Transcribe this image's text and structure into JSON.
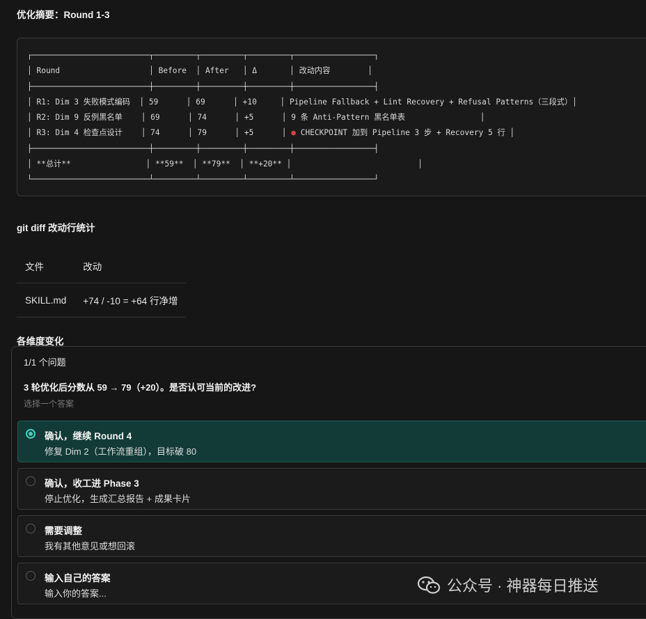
{
  "summary": {
    "title": "优化摘要：Round 1-3",
    "table_ascii": "┌─────────────────────────┬─────────┬─────────┬─────────┬─────────────────┐\n│ Round                   │ Before  │ After   │ Δ       │ 改动内容        │\n├─────────────────────────┼─────────┼─────────┼─────────┼─────────────────┤\n│ R1: Dim 3 失败模式编码  │ 59      │ 69      │ +10     │ Pipeline Fallback + Lint Recovery + Refusal Patterns（三段式）│\n│ R2: Dim 9 反例黑名单    │ 69      │ 74      │ +5      │ 9 条 Anti-Pattern 黑名单表                │\n│ R3: Dim 4 检查点设计    │ 74      │ 79      │ +5      │ ● CHECKPOINT 加到 Pipeline 3 步 + Recovery 5 行 │\n├─────────────────────────┼─────────┼─────────┼─────────┼─────────────────┤\n│ **总计**                │ **59**  │ **79**  │ **+20** │                           │\n└─────────────────────────┴─────────┴─────────┴─────────┴─────────────────┘"
  },
  "diff": {
    "title": "git diff 改动行统计",
    "headers": [
      "文件",
      "改动"
    ],
    "rows": [
      [
        "SKILL.md",
        "+74 / -10 = +64 行净增"
      ]
    ]
  },
  "dimensions": {
    "title": "各维度变化"
  },
  "question": {
    "count": "1/1 个问题",
    "text": "3 轮优化后分数从 59 → 79（+20）。是否认可当前的改进?",
    "hint": "选择一个答案",
    "options": [
      {
        "title": "确认，继续 Round 4",
        "desc": "修复 Dim 2（工作流重组），目标破 80",
        "selected": true
      },
      {
        "title": "确认，收工进 Phase 3",
        "desc": "停止优化，生成汇总报告 + 成果卡片",
        "selected": false
      },
      {
        "title": "需要调整",
        "desc": "我有其他意见或想回滚",
        "selected": false
      },
      {
        "title": "输入自己的答案",
        "desc": "输入你的答案...",
        "selected": false
      }
    ]
  },
  "watermark": {
    "text": "公众号 · 神器每日推送",
    "icon": "wechat-icon"
  },
  "colors": {
    "background": "#161616",
    "selected_option_bg": "#123b37",
    "radio_accent": "#3fd1bd",
    "checkpoint_dot": "#d94040"
  }
}
